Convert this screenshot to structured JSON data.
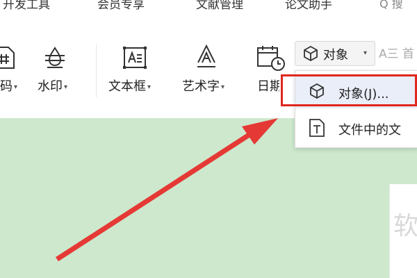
{
  "tabs": [
    {
      "label": "开发工具"
    },
    {
      "label": "会员专享"
    },
    {
      "label": "文献管理"
    },
    {
      "label": "论文助手"
    }
  ],
  "search": {
    "label": "Q 搜"
  },
  "ribbon": {
    "qrcode_label": "码",
    "watermark_label": "水印",
    "textbox_label": "文本框",
    "wordart_label": "艺术字",
    "date_label": "日期",
    "object_label": "对象",
    "ae_label": "A三 首"
  },
  "object_menu": {
    "items": [
      {
        "label": "对象(J)..."
      },
      {
        "label": "文件中的文"
      }
    ]
  },
  "page": {
    "watermark_text": "软"
  },
  "colors": {
    "doc_background": "#cde8cd",
    "highlight": "#e0261e",
    "menu_active": "#e9eef8"
  }
}
